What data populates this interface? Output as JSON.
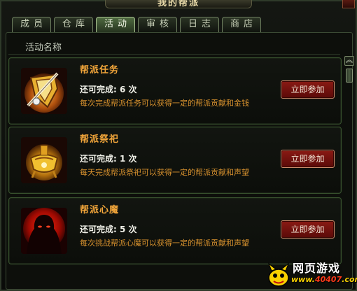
{
  "window": {
    "title": "我的帮派"
  },
  "tabs": [
    {
      "label": "成员",
      "active": false
    },
    {
      "label": "仓库",
      "active": false
    },
    {
      "label": "活动",
      "active": true
    },
    {
      "label": "审核",
      "active": false
    },
    {
      "label": "日志",
      "active": false
    },
    {
      "label": "商店",
      "active": false
    }
  ],
  "list": {
    "header": "活动名称",
    "rows": [
      {
        "name": "帮派任务",
        "count": "还可完成: 6 次",
        "desc": "每次完成帮派任务可以获得一定的帮派贡献和金钱",
        "button": "立即参加",
        "icon": "sword-shield-icon"
      },
      {
        "name": "帮派祭祀",
        "count": "还可完成: 1 次",
        "desc": "每天完成帮派祭祀可以获得一定的帮派贡献和声望",
        "button": "立即参加",
        "icon": "incense-burner-icon"
      },
      {
        "name": "帮派心魔",
        "count": "还可完成: 5 次",
        "desc": "每次挑战帮派心魔可以获得一定的帮派贡献和声望",
        "button": "立即参加",
        "icon": "demon-silhouette-icon"
      }
    ]
  },
  "scrollbar": {
    "up_glyph": "︽"
  },
  "watermark": {
    "title": "网页游戏",
    "url_prefix": "www.",
    "url_site": "40407",
    "url_suffix": ".com"
  },
  "colors": {
    "accent": "#f3a63a",
    "desc": "#d8922e",
    "button": "#8a1a14",
    "tab_active": "#4f6a40"
  }
}
